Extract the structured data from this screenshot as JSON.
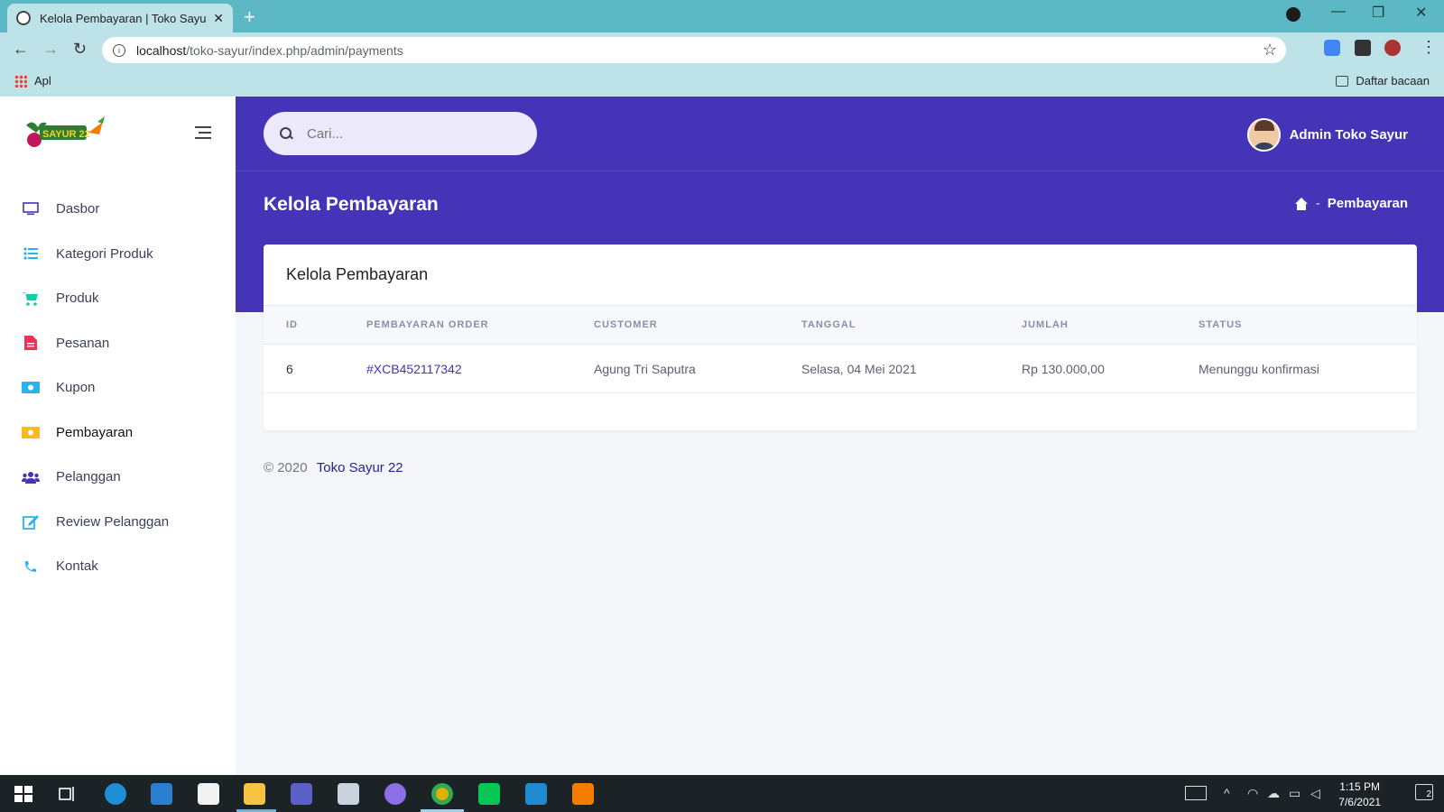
{
  "browser": {
    "tab_title": "Kelola Pembayaran | Toko Sayur 22",
    "url_host": "localhost",
    "url_path": "/toko-sayur/index.php/admin/payments",
    "bookmark_apps": "Apl",
    "reading_list": "Daftar bacaan"
  },
  "sidebar": {
    "items": [
      {
        "label": "Dasbor",
        "icon": "monitor-icon",
        "color": "#4634b8"
      },
      {
        "label": "Kategori Produk",
        "icon": "list-icon",
        "color": "#2bb3f0"
      },
      {
        "label": "Produk",
        "icon": "cart-icon",
        "color": "#1ec9a8"
      },
      {
        "label": "Pesanan",
        "icon": "document-icon",
        "color": "#f0325a"
      },
      {
        "label": "Kupon",
        "icon": "money-icon",
        "color": "#2bb3f0"
      },
      {
        "label": "Pembayaran",
        "icon": "money-icon",
        "color": "#f7b924"
      },
      {
        "label": "Pelanggan",
        "icon": "users-icon",
        "color": "#4634b8"
      },
      {
        "label": "Review Pelanggan",
        "icon": "edit-icon",
        "color": "#2bb3f0"
      },
      {
        "label": "Kontak",
        "icon": "phone-icon",
        "color": "#2bb3f0"
      }
    ]
  },
  "header": {
    "search_placeholder": "Cari...",
    "user_name": "Admin Toko Sayur"
  },
  "page": {
    "title": "Kelola Pembayaran",
    "breadcrumb_sep": "-",
    "breadcrumb_current": "Pembayaran"
  },
  "card": {
    "title": "Kelola Pembayaran",
    "columns": [
      "ID",
      "PEMBAYARAN ORDER",
      "CUSTOMER",
      "TANGGAL",
      "JUMLAH",
      "STATUS"
    ],
    "rows": [
      {
        "id": "6",
        "order": "#XCB452117342",
        "customer": "Agung Tri Saputra",
        "date": "Selasa, 04 Mei 2021",
        "amount": "Rp 130.000,00",
        "status": "Menunggu konfirmasi"
      }
    ]
  },
  "footer": {
    "copyright": "© 2020",
    "brand": "Toko Sayur 22"
  },
  "taskbar": {
    "time": "1:15 PM",
    "date": "7/6/2021",
    "notifications": "2"
  },
  "colors": {
    "brand_primary": "#4634b8",
    "page_bg": "#f5f6fa"
  }
}
